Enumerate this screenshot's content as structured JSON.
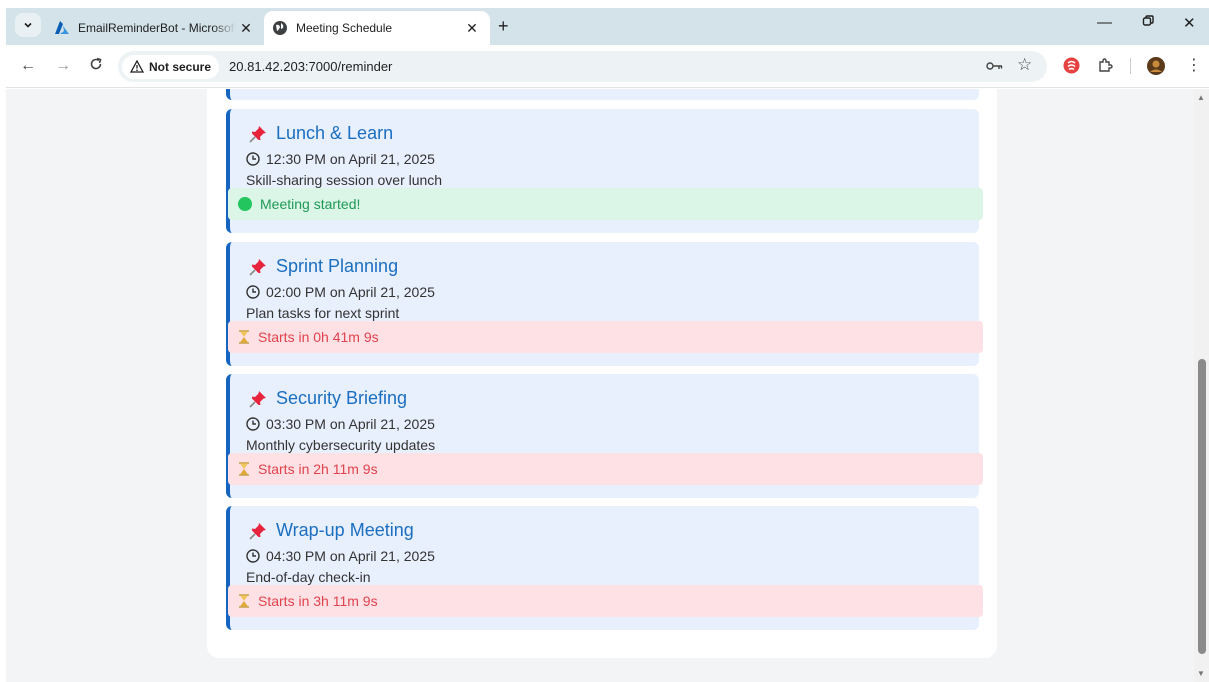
{
  "browser": {
    "tabs": [
      {
        "title": "EmailReminderBot - Microsoft /",
        "icon": "azure-icon",
        "active": false
      },
      {
        "title": "Meeting Schedule",
        "icon": "globe-icon",
        "active": true
      }
    ],
    "security_label": "Not secure",
    "url": "20.81.42.203:7000/reminder"
  },
  "meetings": [
    {
      "title": "Lunch & Learn",
      "time": "12:30 PM on April 21, 2025",
      "description": "Skill-sharing session over lunch",
      "status": "Meeting started!",
      "state": "started"
    },
    {
      "title": "Sprint Planning",
      "time": "02:00 PM on April 21, 2025",
      "description": "Plan tasks for next sprint",
      "status": "Starts in 0h 41m 9s",
      "state": "pending"
    },
    {
      "title": "Security Briefing",
      "time": "03:30 PM on April 21, 2025",
      "description": "Monthly cybersecurity updates",
      "status": "Starts in 2h 11m 9s",
      "state": "pending"
    },
    {
      "title": "Wrap-up Meeting",
      "time": "04:30 PM on April 21, 2025",
      "description": "End-of-day check-in",
      "status": "Starts in 3h 11m 9s",
      "state": "pending"
    }
  ],
  "colors": {
    "accent": "#1565c0",
    "title": "#1b6fc0",
    "started_bg": "#dbf5e6",
    "pending_bg": "#fde1e4"
  }
}
